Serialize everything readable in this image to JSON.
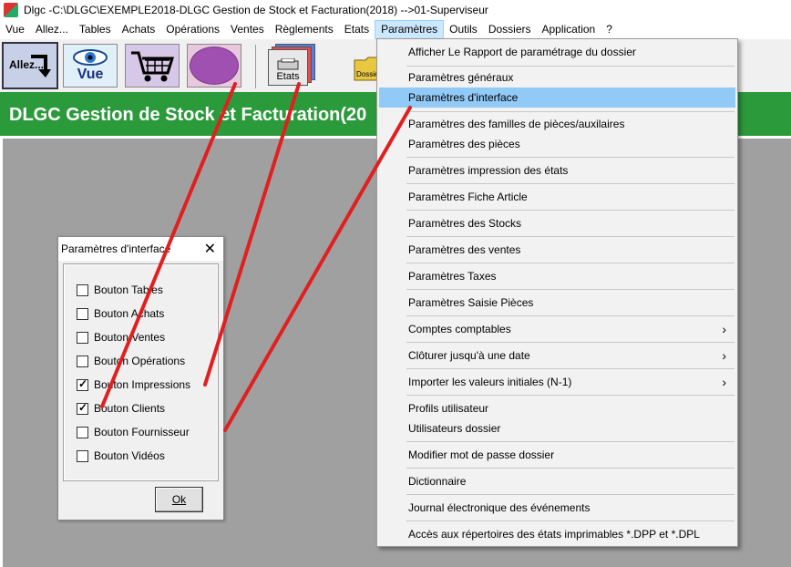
{
  "window": {
    "title": "Dlgc -C:\\DLGC\\EXEMPLE2018-DLGC Gestion de Stock et Facturation(2018) -->01-Superviseur"
  },
  "menubar": {
    "items": [
      "Vue",
      "Allez...",
      "Tables",
      "Achats",
      "Opérations",
      "Ventes",
      "Règlements",
      "Etats",
      "Paramètres",
      "Outils",
      "Dossiers",
      "Application",
      "?"
    ],
    "active": "Paramètres"
  },
  "toolbar": {
    "allez_label": "Allez...",
    "vue_label": "Vue",
    "etats_label": "Etats",
    "dossier_label": "Dossier"
  },
  "banner": {
    "text": "DLGC Gestion de Stock et Facturation(20"
  },
  "dialog": {
    "title": "Paramètres d'interface",
    "close": "✕",
    "checkboxes": [
      {
        "label": "Bouton Tables",
        "checked": false
      },
      {
        "label": "Bouton Achats",
        "checked": false
      },
      {
        "label": "Bouton Ventes",
        "checked": false
      },
      {
        "label": "Bouton Opérations",
        "checked": false
      },
      {
        "label": "Bouton Impressions",
        "checked": true
      },
      {
        "label": "Bouton Clients",
        "checked": true
      },
      {
        "label": "Bouton Fournisseur",
        "checked": false
      },
      {
        "label": "Bouton Vidéos",
        "checked": false
      }
    ],
    "ok_label": "Ok"
  },
  "dropdown": {
    "items": [
      {
        "label": "Afficher Le Rapport de paramétrage du dossier",
        "submenu": false
      },
      {
        "label": "Paramètres généraux",
        "submenu": false
      },
      {
        "label": "Paramètres d'interface",
        "submenu": false,
        "highlight": true
      },
      {
        "label": "Paramètres des familles de pièces/auxilaires",
        "submenu": false
      },
      {
        "label": "Paramètres des pièces",
        "submenu": false
      },
      {
        "label": "Paramètres impression des états",
        "submenu": false
      },
      {
        "label": "Paramètres Fiche Article",
        "submenu": false
      },
      {
        "label": "Paramètres des Stocks",
        "submenu": false
      },
      {
        "label": "Paramètres des ventes",
        "submenu": false
      },
      {
        "label": "Paramètres Taxes",
        "submenu": false
      },
      {
        "label": "Paramètres Saisie Pièces",
        "submenu": false
      },
      {
        "label": "Comptes comptables",
        "submenu": true
      },
      {
        "label": "Clôturer jusqu'à une date",
        "submenu": true
      },
      {
        "label": "Importer les valeurs initiales (N-1)",
        "submenu": true
      },
      {
        "label": "Profils utilisateur",
        "submenu": false
      },
      {
        "label": "Utilisateurs dossier",
        "submenu": false
      },
      {
        "label": "Modifier mot de passe dossier",
        "submenu": false
      },
      {
        "label": "Dictionnaire",
        "submenu": false
      },
      {
        "label": "Journal électronique des événements",
        "submenu": false
      },
      {
        "label": "Accès aux répertoires des états imprimables *.DPP et *.DPL",
        "submenu": false
      }
    ]
  },
  "colors": {
    "banner": "#2b9a3b",
    "menu_highlight": "#91c9f7",
    "annotation_line": "#e02020"
  }
}
